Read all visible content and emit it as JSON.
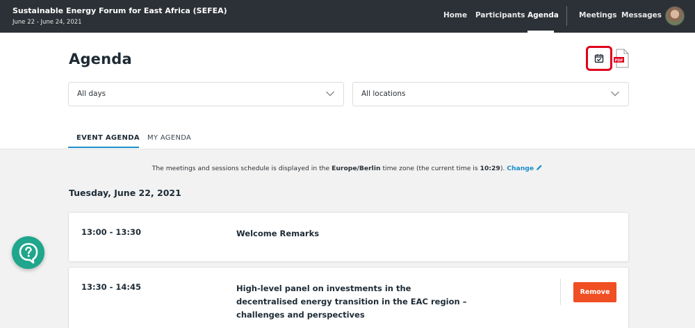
{
  "event": {
    "title": "Sustainable Energy Forum for East Africa (SEFEA)",
    "dates": "June 22 - June 24, 2021"
  },
  "nav": {
    "home": "Home",
    "participants": "Participants",
    "agenda": "Agenda",
    "meetings": "Meetings",
    "messages": "Messages"
  },
  "page": {
    "title": "Agenda",
    "pdf_label": "PDF"
  },
  "filters": {
    "days": "All days",
    "locations": "All locations"
  },
  "tabs": {
    "event_agenda": "EVENT AGENDA",
    "my_agenda": "MY AGENDA"
  },
  "timezone": {
    "prefix": "The meetings and sessions schedule is displayed in the ",
    "zone": "Europe/Berlin",
    "middle": " time zone (the current time is ",
    "time": "10:29",
    "suffix": "). ",
    "change": "Change"
  },
  "day": {
    "heading": "Tuesday, June 22, 2021"
  },
  "sessions": [
    {
      "time": "13:00 - 13:30",
      "title": "Welcome Remarks"
    },
    {
      "time": "13:30 - 14:45",
      "title": "High-level panel on investments in the decentralised energy transition in the EAC region – challenges and perspectives",
      "action": "Remove"
    }
  ],
  "colors": {
    "topbar": "#2c3137",
    "accent": "#1b8ec9",
    "remove": "#f04e23",
    "highlight": "#e0001b",
    "help": "#1fa68c"
  },
  "icons": {
    "calendar": "calendar-check-icon",
    "pdf": "pdf-file-icon",
    "chevron": "chevron-down-icon",
    "pencil": "pencil-icon",
    "help": "chat-question-icon"
  }
}
